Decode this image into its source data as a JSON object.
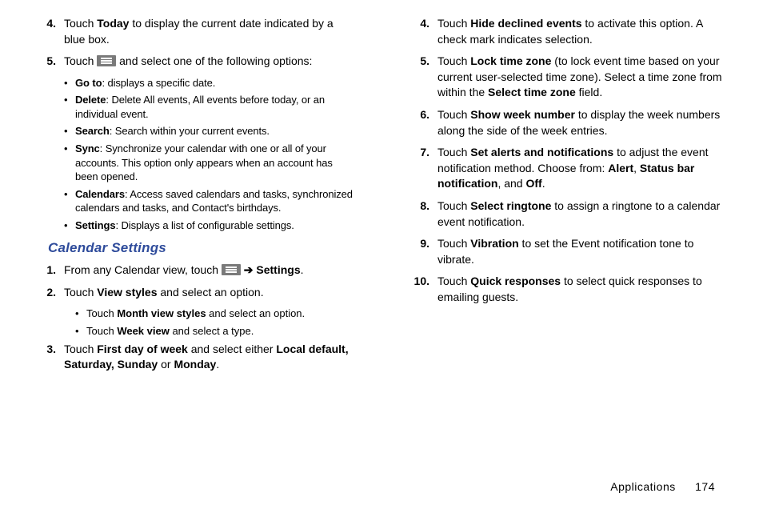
{
  "left": {
    "items": [
      {
        "n": "4.",
        "html": "Touch <b>Today</b> to display the current date indicated by a blue box."
      },
      {
        "n": "5.",
        "html": "Touch {MENU} and select one of the following options:"
      }
    ],
    "bullets5": [
      {
        "html": "<b>Go to</b>: displays a specific date."
      },
      {
        "html": "<b>Delete</b>: Delete All events, All events before today, or an individual event."
      },
      {
        "html": "<b>Search</b>: Search within your current events."
      },
      {
        "html": "<b>Sync</b>: Synchronize your calendar with one or all of your accounts. This option only appears when an account has been opened."
      },
      {
        "html": "<b>Calendars</b>: Access saved calendars and tasks, synchronized calendars and tasks, and Contact's birthdays."
      },
      {
        "html": "<b>Settings</b>: Displays a list of configurable settings."
      }
    ],
    "heading": "Calendar Settings",
    "settingsItems": [
      {
        "n": "1.",
        "html": "From any Calendar view, touch {MENU} {ARROW} <b>Settings</b>."
      },
      {
        "n": "2.",
        "html": "Touch <b>View styles</b> and select an option."
      }
    ],
    "subBullets2": [
      {
        "html": "Touch <b>Month view styles</b> and select an option."
      },
      {
        "html": "Touch <b>Week view</b> and select a type."
      }
    ],
    "settingsItems2": [
      {
        "n": "3.",
        "html": "Touch <b>First day of week</b> and select either <b>Local default, Saturday, Sunday</b> or <b>Monday</b>."
      }
    ]
  },
  "right": {
    "items": [
      {
        "n": "4.",
        "html": "Touch <b>Hide declined events</b> to activate this option. A check mark indicates selection."
      },
      {
        "n": "5.",
        "html": "Touch <b>Lock time zone</b> (to lock event time based on your current user-selected time zone). Select a time zone from within the <b>Select time zone</b> field."
      },
      {
        "n": "6.",
        "html": "Touch <b>Show week number</b> to display the week numbers along the side of the week entries."
      },
      {
        "n": "7.",
        "html": "Touch <b>Set alerts and notifications</b> to adjust the event notification method. Choose from: <b>Alert</b>, <b>Status bar notification</b>, and <b>Off</b>."
      },
      {
        "n": "8.",
        "html": "Touch <b>Select ringtone</b> to assign a ringtone to a calendar event notification."
      },
      {
        "n": "9.",
        "html": "Touch <b>Vibration</b> to set the Event notification tone to vibrate."
      },
      {
        "n": "10.",
        "html": "Touch <b>Quick responses</b> to select quick responses to emailing guests."
      }
    ]
  },
  "footer": {
    "section": "Applications",
    "page": "174"
  }
}
